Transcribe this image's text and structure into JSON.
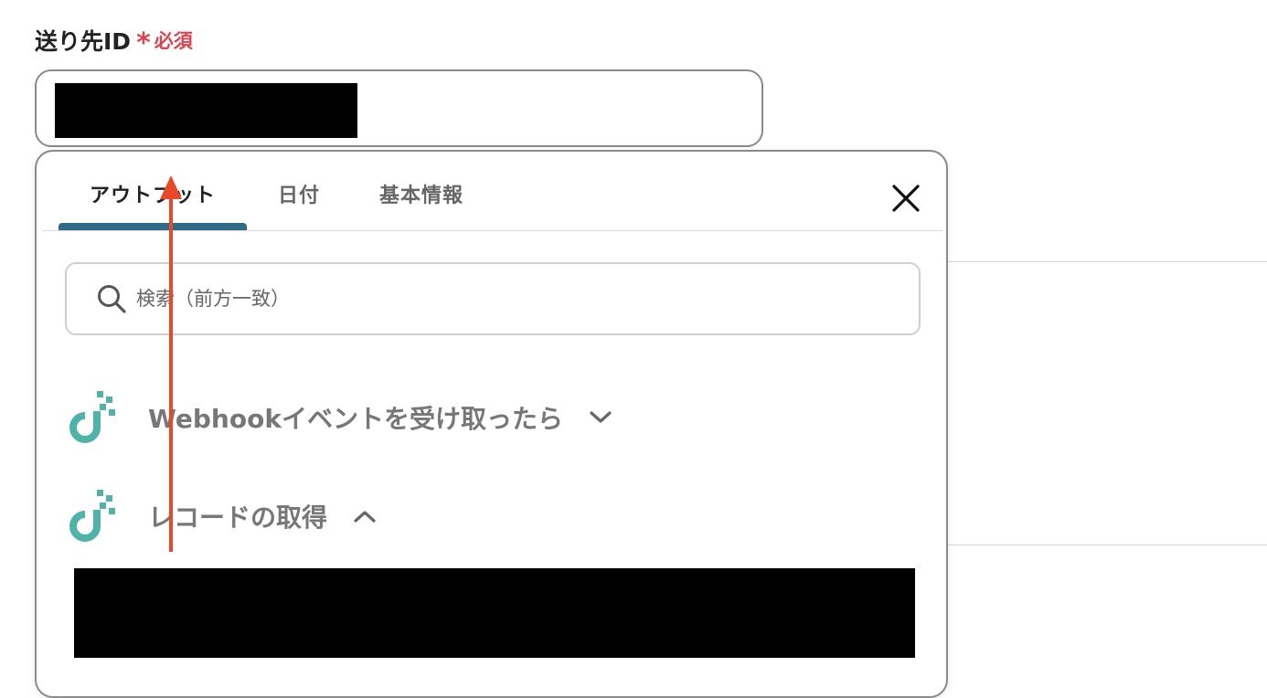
{
  "field": {
    "label": "送り先ID",
    "required_mark": "*",
    "required_text": "必須"
  },
  "popup": {
    "tabs": [
      {
        "label": "アウトプット",
        "active": true
      },
      {
        "label": "日付",
        "active": false
      },
      {
        "label": "基本情報",
        "active": false
      }
    ],
    "search": {
      "placeholder": "検索（前方一致）"
    },
    "sections": [
      {
        "title": "Webhookイベントを受け取ったら",
        "expanded": false,
        "icon": "app-logo-icon"
      },
      {
        "title": "レコードの取得",
        "expanded": true,
        "icon": "app-logo-icon"
      }
    ]
  },
  "colors": {
    "accent": "#2f6b86",
    "required": "#e0434f",
    "logo": "#4fb3aa",
    "annotation_arrow": "#e8492a"
  }
}
